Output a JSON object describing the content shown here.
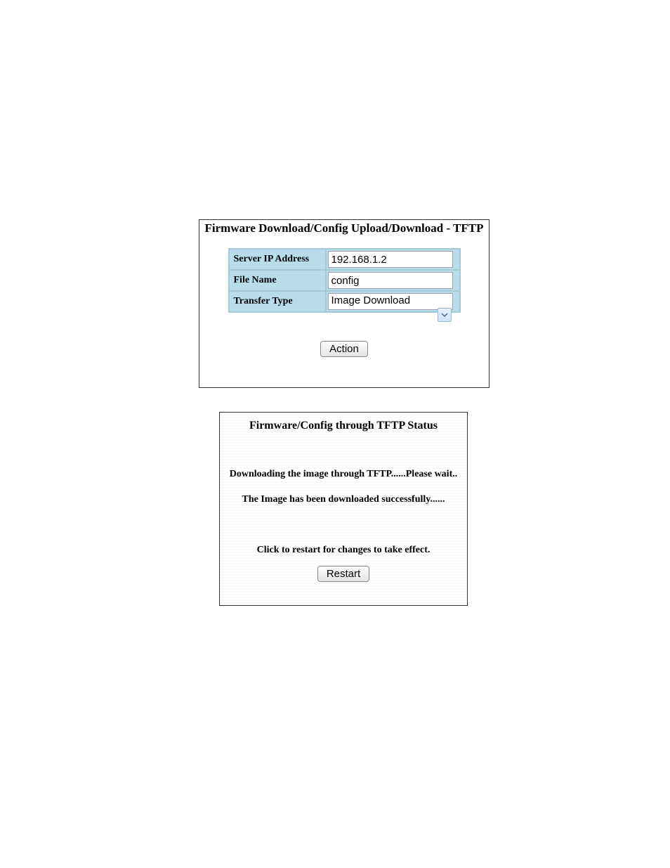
{
  "panel1": {
    "title": "Firmware Download/Config Upload/Download - TFTP",
    "rows": {
      "server_ip": {
        "label": "Server IP Address",
        "value": "192.168.1.2"
      },
      "file_name": {
        "label": "File Name",
        "value": "config"
      },
      "transfer_type": {
        "label": "Transfer Type",
        "value": "Image Download"
      }
    },
    "action_button": "Action"
  },
  "panel2": {
    "title": "Firmware/Config through TFTP Status",
    "status1": "Downloading the image through TFTP......Please wait..",
    "status2": "The Image has been downloaded successfully......",
    "restart_msg": "Click to restart for changes to take effect.",
    "restart_button": "Restart"
  }
}
